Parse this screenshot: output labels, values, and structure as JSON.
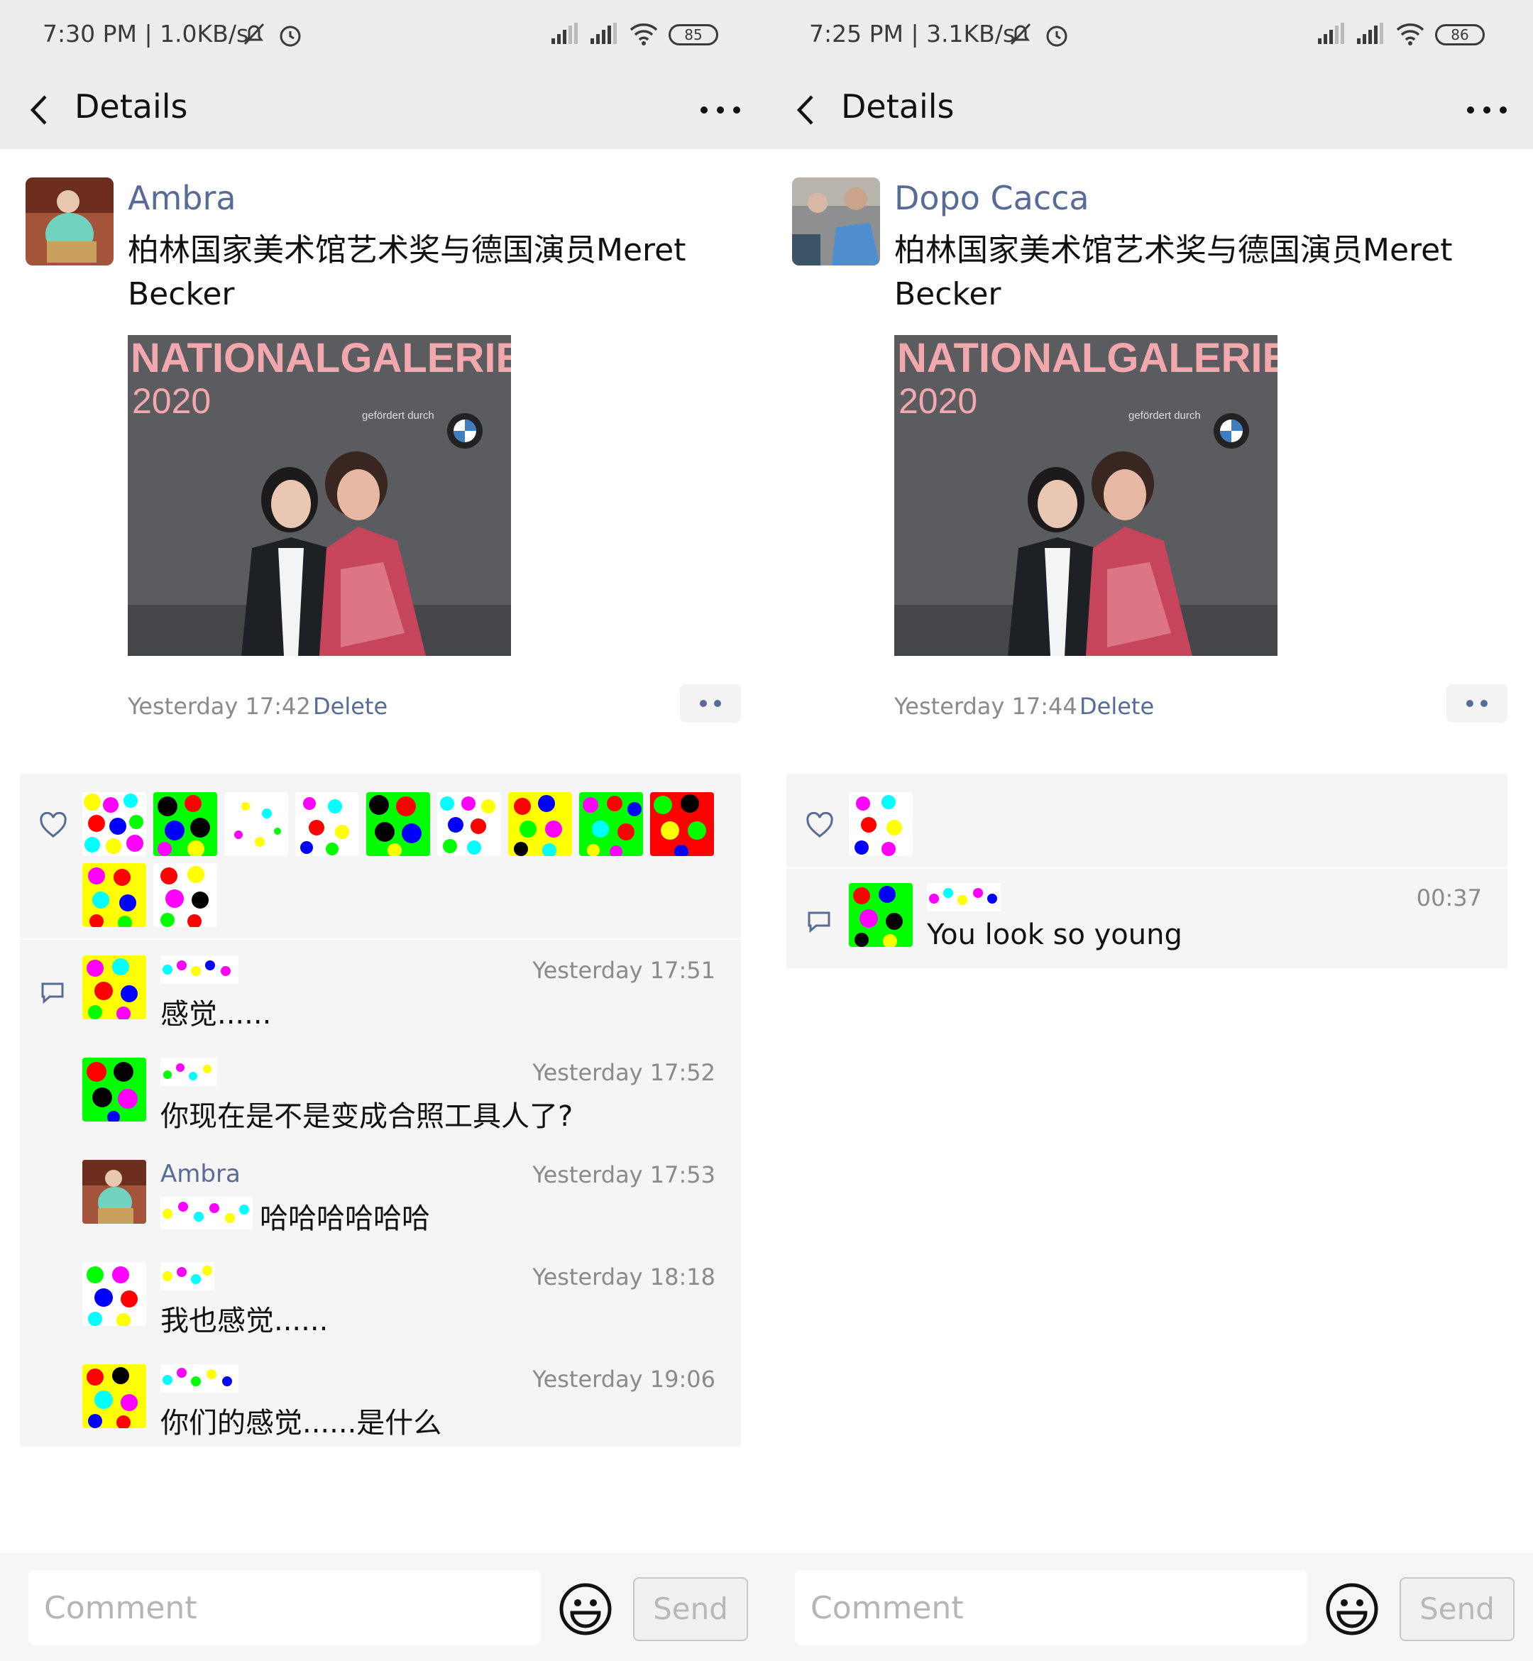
{
  "panels": [
    {
      "status": {
        "time": "7:30 PM | 1.0KB/s",
        "battery": "85"
      },
      "header": {
        "title": "Details"
      },
      "post": {
        "author": "Ambra",
        "text": "柏林国家美术馆艺术奖与德国演员Meret Becker",
        "photo": {
          "line1": "NATIONALGALERIE",
          "line2": "2020",
          "sponsor": "gefördert durch"
        },
        "time": "Yesterday 17:42",
        "delete_label": "Delete"
      },
      "likes_count": 11,
      "comments": [
        {
          "name": "",
          "time": "Yesterday 17:51",
          "text": "感觉......"
        },
        {
          "name": "",
          "time": "Yesterday 17:52",
          "text": "你现在是不是变成合照工具人了?"
        },
        {
          "name": "Ambra",
          "time": "Yesterday 17:53",
          "text": "哈哈哈哈哈哈"
        },
        {
          "name": "",
          "time": "Yesterday 18:18",
          "text": "我也感觉......"
        },
        {
          "name": "",
          "time": "Yesterday 19:06",
          "text": "你们的感觉......是什么"
        }
      ],
      "comment_bar": {
        "placeholder": "Comment",
        "send_label": "Send"
      }
    },
    {
      "status": {
        "time": "7:25 PM | 3.1KB/s",
        "battery": "86"
      },
      "header": {
        "title": "Details"
      },
      "post": {
        "author": "Dopo Cacca",
        "text": "柏林国家美术馆艺术奖与德国演员Meret Becker",
        "photo": {
          "line1": "NATIONALGALERIE",
          "line2": "2020",
          "sponsor": "gefördert durch"
        },
        "time": "Yesterday 17:44",
        "delete_label": "Delete"
      },
      "likes_count": 1,
      "comments": [
        {
          "name": "",
          "time": "00:37",
          "text": "You look so young"
        }
      ],
      "comment_bar": {
        "placeholder": "Comment",
        "send_label": "Send"
      }
    }
  ],
  "colors": {
    "link": "#576b95",
    "header_bg": "#ededed",
    "section_bg": "#f5f5f5"
  },
  "icons": [
    "back-arrow-icon",
    "more-icon",
    "heart-icon",
    "comment-bubble-icon",
    "emoji-icon",
    "signal-icon",
    "wifi-icon",
    "battery-icon",
    "mute-bell-icon",
    "alarm-icon"
  ]
}
